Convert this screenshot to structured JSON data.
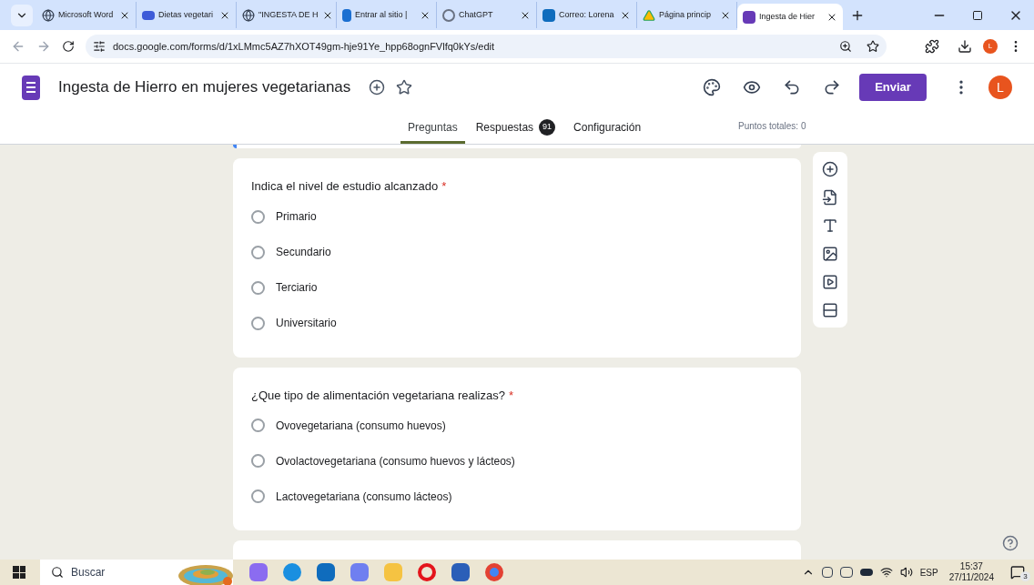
{
  "browser_tabs": [
    {
      "title": "Microsoft Word",
      "kind": "globe",
      "selected": false
    },
    {
      "title": "Dietas vegetari",
      "kind": "uoc",
      "selected": false
    },
    {
      "title": "\"INGESTA DE H",
      "kind": "globe",
      "selected": false
    },
    {
      "title": "Entrar al sitio |",
      "kind": "b",
      "selected": false
    },
    {
      "title": "ChatGPT",
      "kind": "chatgpt",
      "selected": false
    },
    {
      "title": "Correo: Lorena",
      "kind": "outlook",
      "selected": false
    },
    {
      "title": "Página princip",
      "kind": "drive",
      "selected": false
    },
    {
      "title": "Ingesta de Hier",
      "kind": "forms",
      "selected": true
    }
  ],
  "required_mark": "*",
  "address_bar": {
    "url": "docs.google.com/forms/d/1xLMmc5AZ7hXOT49gm-hje91Ye_hpp68ognFVlfq0kYs/edit"
  },
  "profile_initial": "L",
  "form_header": {
    "title": "Ingesta de Hierro en mujeres vegetarianas",
    "send_button": "Enviar",
    "avatar": "L"
  },
  "form_tabs": [
    {
      "label": "Preguntas",
      "selected": true
    },
    {
      "label": "Respuestas",
      "badge": "91",
      "selected": false
    },
    {
      "label": "Configuración",
      "selected": false
    }
  ],
  "total_points": "Puntos totales: 0",
  "questions": [
    {
      "title": "Indica el nivel de estudio alcanzado",
      "required": true,
      "options": [
        {
          "label": "Primario",
          "selected": false
        },
        {
          "label": "Secundario",
          "selected": false
        },
        {
          "label": "Terciario",
          "selected": false
        },
        {
          "label": "Universitario",
          "selected": false
        }
      ]
    },
    {
      "title": "¿Que tipo de alimentación vegetariana realizas?",
      "required": true,
      "options": [
        {
          "label": "Ovovegetariana (consumo huevos)",
          "selected": false
        },
        {
          "label": "Ovolactovegetariana (consumo huevos y lácteos)",
          "selected": false
        },
        {
          "label": "Lactovegetariana (consumo lácteos)",
          "selected": false
        }
      ]
    }
  ],
  "taskbar": {
    "search_placeholder": "Buscar",
    "language": "ESP",
    "time": "15:37",
    "date": "27/11/2024",
    "notifications": "3"
  }
}
